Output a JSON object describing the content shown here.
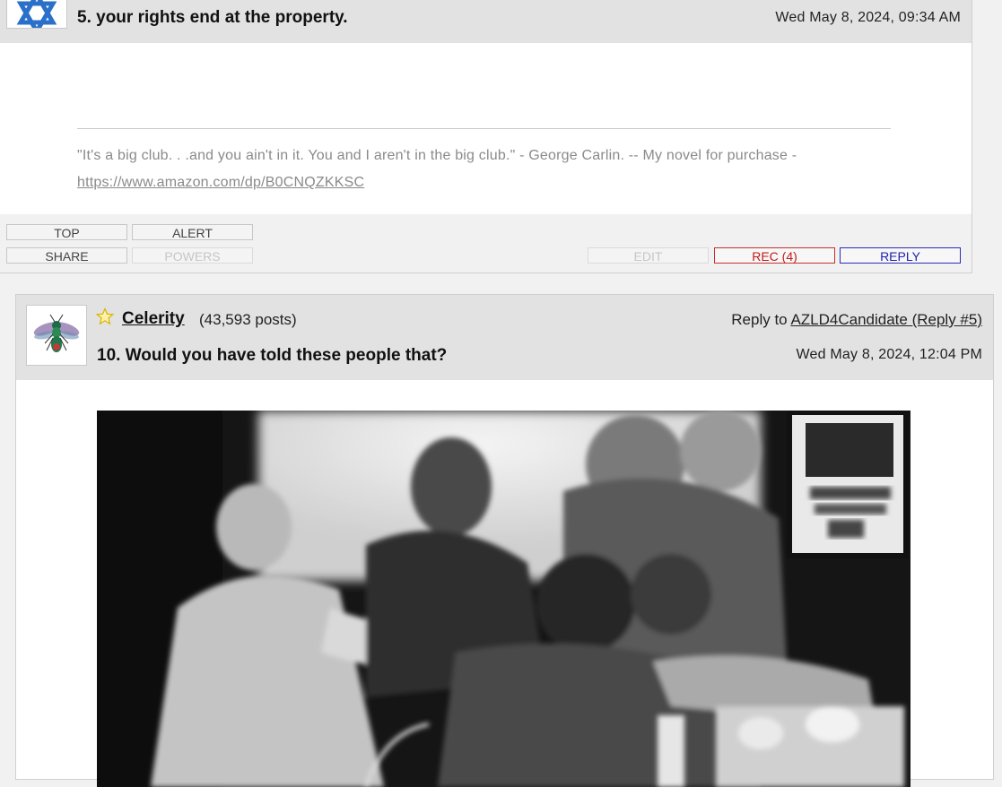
{
  "post5": {
    "title": "5. your rights end at the property.",
    "date": "Wed May 8, 2024, 09:34 AM",
    "signature_text": "\"It's a big club. . .and you ain't in it. You and I aren't in the big club.\" - George Carlin. -- My novel for purchase -",
    "signature_link": "https://www.amazon.com/dp/B0CNQZKKSC",
    "avatar_icon": "star-of-david-icon",
    "buttons": {
      "top": "TOP",
      "alert": "ALERT",
      "share": "SHARE",
      "powers": "POWERS",
      "edit": "EDIT",
      "rec": "REC (4)",
      "reply": "REPLY"
    }
  },
  "post10": {
    "author": "Celerity",
    "post_count": "(43,593 posts)",
    "reply_to_label": "Reply to",
    "reply_to_link": "AZLD4Candidate (Reply #5)",
    "title": "10. Would you have told these people that?",
    "date": "Wed May 8, 2024, 12:04 PM",
    "avatar_icon": "wasp-icon",
    "star_icon": "star-outline-icon"
  },
  "colors": {
    "header_bg": "#e2e2e2",
    "page_bg": "#f1f1f1",
    "rec_red": "#c21a1a",
    "reply_blue": "#2020b0",
    "star_yellow": "#f2d02a"
  }
}
